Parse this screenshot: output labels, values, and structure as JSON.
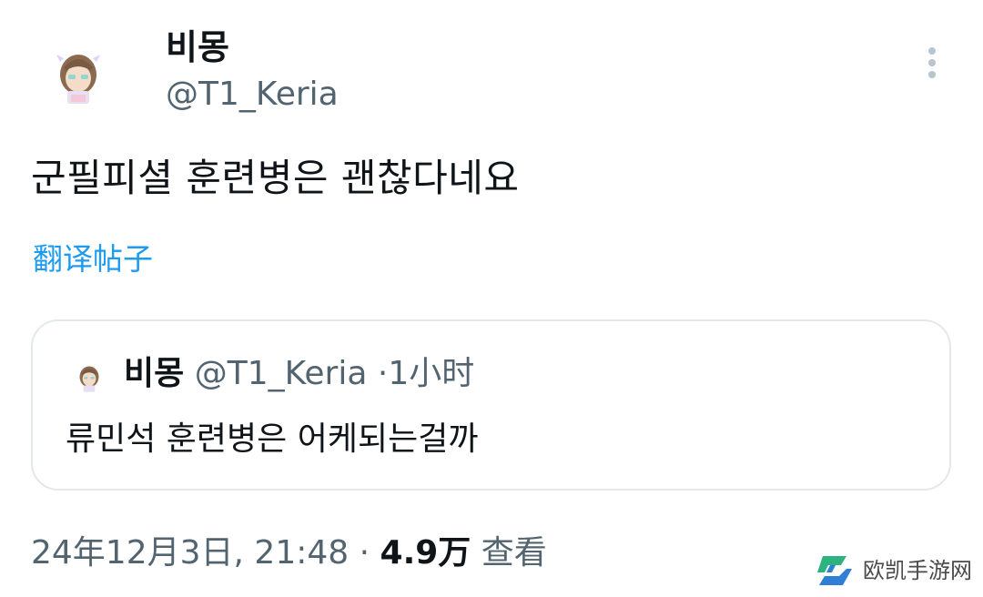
{
  "author": {
    "display_name": "비몽",
    "handle": "@T1_Keria",
    "avatar_icon": "avatar-icon"
  },
  "menu": {
    "icon": "more-vertical-icon"
  },
  "tweet": {
    "text": "군필피셜 훈련병은 괜찮다네요",
    "translate_label": "翻译帖子"
  },
  "quote": {
    "display_name": "비몽",
    "handle": "@T1_Keria",
    "separator": "·",
    "time": "1小时",
    "text": "류민석 훈련병은 어케되는걸까"
  },
  "footer": {
    "timestamp": "24年12月3日, 21:48",
    "separator": "·",
    "views_count": "4.9万",
    "views_label": "查看"
  },
  "watermark": {
    "text": "欧凯手游网",
    "icon": "ok-logo-icon"
  },
  "colors": {
    "accent": "#1d9bf0",
    "secondary_text": "#536471",
    "border": "#e4e8eb"
  }
}
